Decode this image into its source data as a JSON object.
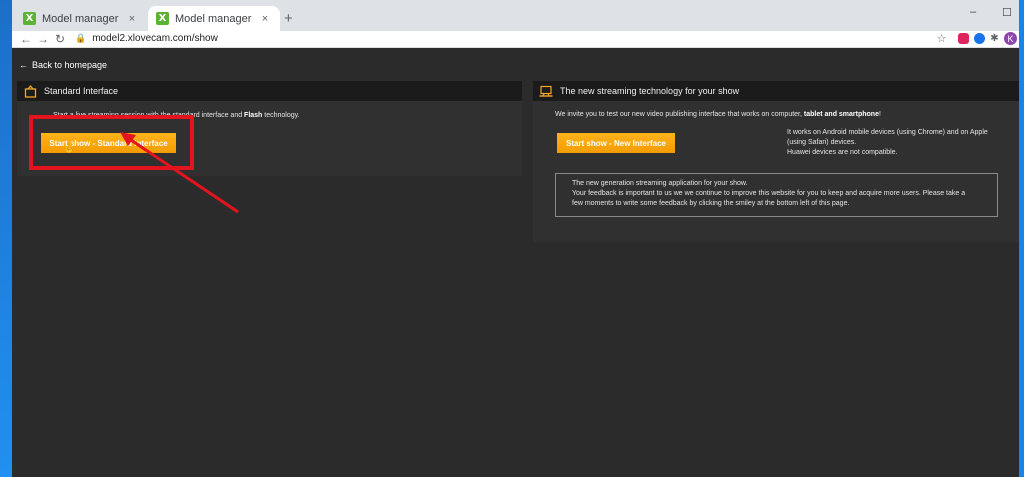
{
  "tabs": [
    {
      "label": "Model manager - Settings",
      "favicon": "X",
      "active": false
    },
    {
      "label": "Model manager - Show",
      "favicon": "X",
      "active": true
    }
  ],
  "tab_close_glyph": "×",
  "newtab_glyph": "+",
  "window": {
    "minimize": "–",
    "maximize": "☐"
  },
  "nav": {
    "back": "←",
    "forward": "→",
    "reload": "↻"
  },
  "address_bar": {
    "url": "model2.xlovecam.com/show"
  },
  "profile_initial": "K",
  "page": {
    "back_link": "Back to homepage",
    "standard": {
      "title": "Standard Interface",
      "description_pre": "Start a live streaming session with the standard interface and ",
      "description_bold": "Flash",
      "description_post": " technology.",
      "button": "Start show - Standard Interface"
    },
    "new": {
      "title": "The new streaming technology for your show",
      "invite_pre": "We invite you to test our new video publishing interface that works on computer, ",
      "invite_bold": "tablet and smartphone",
      "invite_post": "!",
      "button": "Start show - New Interface",
      "compat_line1": "It works on Android mobile devices (using Chrome) and on Apple",
      "compat_line2": "(using Safari) devices.",
      "compat_line3": "Huawei devices are not compatible.",
      "info_line1": "The new generation streaming application for your show.",
      "info_line2": "Your feedback is important to us we we continue to improve this website for you to keep and acquire more users. Please take a",
      "info_line3": "few moments to write some feedback by clicking the smiley at the bottom left of this page."
    }
  },
  "colors": {
    "accent_button": "#f39c00",
    "annotation": "#e4141e",
    "page_bg": "#2b2b2b",
    "panel_header": "#1b1b1b"
  }
}
